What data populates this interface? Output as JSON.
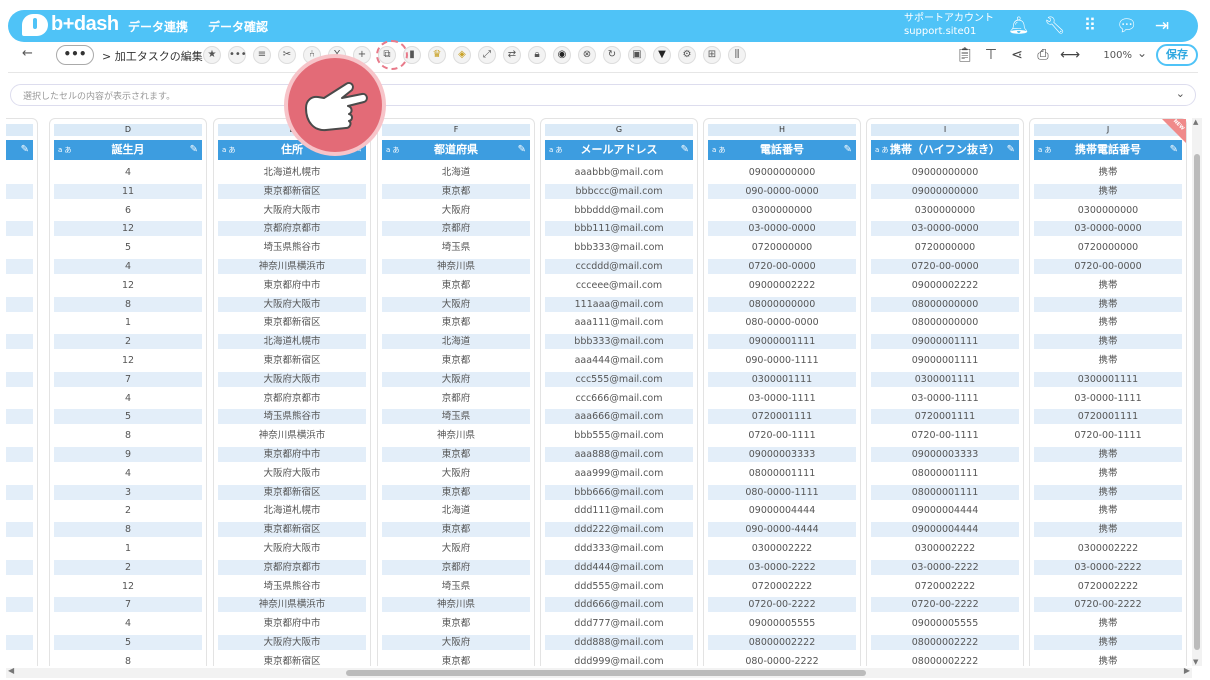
{
  "app": {
    "logo_text": "b+dash",
    "nav": [
      "データ連携",
      "データ確認"
    ],
    "account_line1": "サポートアカウント",
    "account_line2": "support.site01"
  },
  "toolbar": {
    "more_label": "•••",
    "breadcrumb": "> 加工タスクの編集",
    "zoom": "100%",
    "save_label": "保存"
  },
  "cellbar": {
    "placeholder": "選択したセルの内容が表示されます。"
  },
  "columns": [
    {
      "letter": "D",
      "header": "誕生月"
    },
    {
      "letter": "E",
      "header": "住所"
    },
    {
      "letter": "F",
      "header": "都道府県"
    },
    {
      "letter": "G",
      "header": "メールアドレス"
    },
    {
      "letter": "H",
      "header": "電話番号"
    },
    {
      "letter": "I",
      "header": "携帯（ハイフン抜き）"
    },
    {
      "letter": "J",
      "header": "携帯電話番号"
    }
  ],
  "rows": [
    [
      "4",
      "北海道札幌市",
      "北海道",
      "aaabbb@mail.com",
      "09000000000",
      "09000000000",
      "携帯"
    ],
    [
      "11",
      "東京都新宿区",
      "東京都",
      "bbbccc@mail.com",
      "090-0000-0000",
      "09000000000",
      "携帯"
    ],
    [
      "6",
      "大阪府大阪市",
      "大阪府",
      "bbbddd@mail.com",
      "0300000000",
      "0300000000",
      "0300000000"
    ],
    [
      "12",
      "京都府京都市",
      "京都府",
      "bbb111@mail.com",
      "03-0000-0000",
      "03-0000-0000",
      "03-0000-0000"
    ],
    [
      "5",
      "埼玉県熊谷市",
      "埼玉県",
      "bbb333@mail.com",
      "0720000000",
      "0720000000",
      "0720000000"
    ],
    [
      "4",
      "神奈川県横浜市",
      "神奈川県",
      "cccddd@mail.com",
      "0720-00-0000",
      "0720-00-0000",
      "0720-00-0000"
    ],
    [
      "12",
      "東京都府中市",
      "東京都",
      "ccceee@mail.com",
      "09000002222",
      "09000002222",
      "携帯"
    ],
    [
      "8",
      "大阪府大阪市",
      "大阪府",
      "111aaa@mail.com",
      "08000000000",
      "08000000000",
      "携帯"
    ],
    [
      "1",
      "東京都新宿区",
      "東京都",
      "aaa111@mail.com",
      "080-0000-0000",
      "08000000000",
      "携帯"
    ],
    [
      "2",
      "北海道札幌市",
      "北海道",
      "bbb333@mail.com",
      "09000001111",
      "09000001111",
      "携帯"
    ],
    [
      "12",
      "東京都新宿区",
      "東京都",
      "aaa444@mail.com",
      "090-0000-1111",
      "09000001111",
      "携帯"
    ],
    [
      "7",
      "大阪府大阪市",
      "大阪府",
      "ccc555@mail.com",
      "0300001111",
      "0300001111",
      "0300001111"
    ],
    [
      "4",
      "京都府京都市",
      "京都府",
      "ccc666@mail.com",
      "03-0000-1111",
      "03-0000-1111",
      "03-0000-1111"
    ],
    [
      "5",
      "埼玉県熊谷市",
      "埼玉県",
      "aaa666@mail.com",
      "0720001111",
      "0720001111",
      "0720001111"
    ],
    [
      "8",
      "神奈川県横浜市",
      "神奈川県",
      "bbb555@mail.com",
      "0720-00-1111",
      "0720-00-1111",
      "0720-00-1111"
    ],
    [
      "9",
      "東京都府中市",
      "東京都",
      "aaa888@mail.com",
      "09000003333",
      "09000003333",
      "携帯"
    ],
    [
      "4",
      "大阪府大阪市",
      "大阪府",
      "aaa999@mail.com",
      "08000001111",
      "08000001111",
      "携帯"
    ],
    [
      "3",
      "東京都新宿区",
      "東京都",
      "bbb666@mail.com",
      "080-0000-1111",
      "08000001111",
      "携帯"
    ],
    [
      "2",
      "北海道札幌市",
      "北海道",
      "ddd111@mail.com",
      "09000004444",
      "09000004444",
      "携帯"
    ],
    [
      "8",
      "東京都新宿区",
      "東京都",
      "ddd222@mail.com",
      "090-0000-4444",
      "09000004444",
      "携帯"
    ],
    [
      "1",
      "大阪府大阪市",
      "大阪府",
      "ddd333@mail.com",
      "0300002222",
      "0300002222",
      "0300002222"
    ],
    [
      "2",
      "京都府京都市",
      "京都府",
      "ddd444@mail.com",
      "03-0000-2222",
      "03-0000-2222",
      "03-0000-2222"
    ],
    [
      "12",
      "埼玉県熊谷市",
      "埼玉県",
      "ddd555@mail.com",
      "0720002222",
      "0720002222",
      "0720002222"
    ],
    [
      "7",
      "神奈川県横浜市",
      "神奈川県",
      "ddd666@mail.com",
      "0720-00-2222",
      "0720-00-2222",
      "0720-00-2222"
    ],
    [
      "4",
      "東京都府中市",
      "東京都",
      "ddd777@mail.com",
      "09000005555",
      "09000005555",
      "携帯"
    ],
    [
      "5",
      "大阪府大阪市",
      "大阪府",
      "ddd888@mail.com",
      "08000002222",
      "08000002222",
      "携帯"
    ],
    [
      "8",
      "東京都新宿区",
      "東京都",
      "ddd999@mail.com",
      "080-0000-2222",
      "08000002222",
      "携帯"
    ]
  ],
  "badges": {
    "new": "NEW"
  },
  "icons": {
    "top": [
      "bell-icon",
      "wrench-icon",
      "grid-icon",
      "chat-icon",
      "logout-icon"
    ],
    "tools": [
      "star-icon",
      "more-icon",
      "list-icon",
      "scissors-icon",
      "split-icon",
      "merge-icon",
      "plus-icon",
      "copy-icon",
      "trash-icon",
      "crown-icon",
      "tag-icon",
      "expand-icon",
      "refresh-icon",
      "lock-icon",
      "box-icon",
      "close-circle-icon",
      "sync-icon",
      "frame-icon",
      "filter-icon",
      "gear-icon",
      "table-icon",
      "columns-icon"
    ],
    "right": [
      "clipboard-icon",
      "tree-icon",
      "share-icon",
      "export-icon",
      "code-icon"
    ]
  },
  "colors": {
    "primary": "#4fc3f7",
    "header": "#3d9de0",
    "row_alt": "#e3eef9",
    "pointer": "#e36b77"
  }
}
